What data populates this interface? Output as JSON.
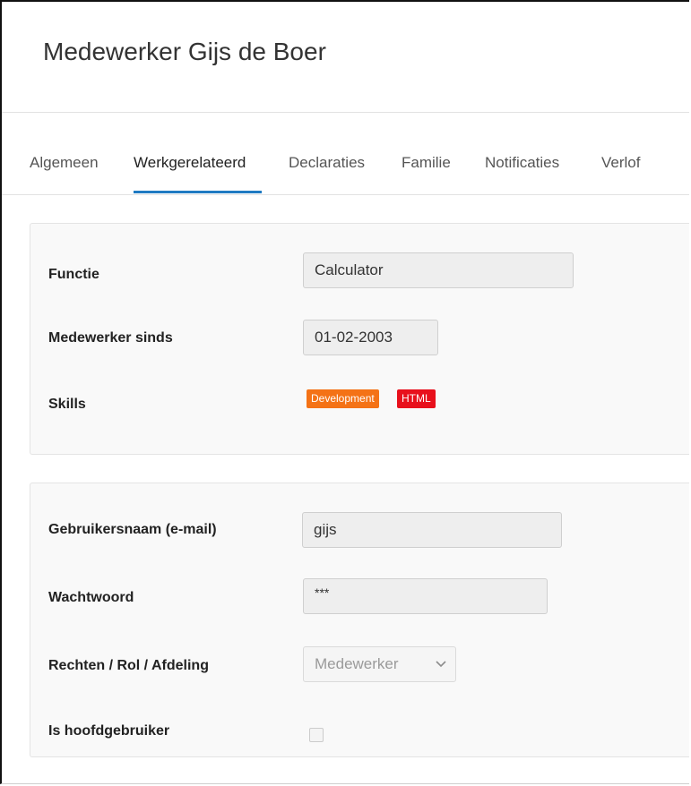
{
  "page": {
    "title": "Medewerker Gijs de Boer"
  },
  "tabs": [
    {
      "label": "Algemeen",
      "active": false
    },
    {
      "label": "Werkgerelateerd",
      "active": true
    },
    {
      "label": "Declaraties",
      "active": false
    },
    {
      "label": "Familie",
      "active": false
    },
    {
      "label": "Notificaties",
      "active": false
    },
    {
      "label": "Verlof",
      "active": false
    }
  ],
  "work": {
    "functie_label": "Functie",
    "functie_value": "Calculator",
    "sinds_label": "Medewerker sinds",
    "sinds_value": "01-02-2003",
    "skills_label": "Skills",
    "skills": [
      {
        "label": "Development",
        "color": "#f47216"
      },
      {
        "label": "HTML",
        "color": "#e8101c"
      }
    ]
  },
  "account": {
    "username_label": "Gebruikersnaam (e-mail)",
    "username_value": "gijs",
    "password_label": "Wachtwoord",
    "password_value": "***",
    "role_label": "Rechten / Rol / Afdeling",
    "role_value": "Medewerker",
    "main_user_label": "Is hoofdgebruiker",
    "main_user_checked": false
  },
  "colors": {
    "accent": "#1f7ac2"
  }
}
